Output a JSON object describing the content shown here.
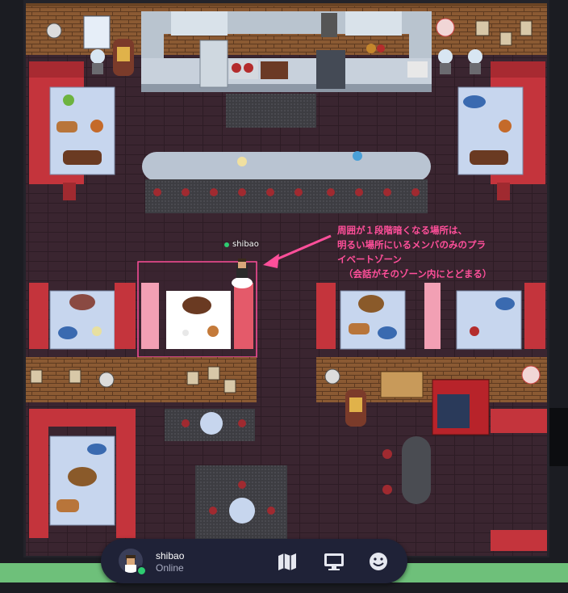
{
  "player": {
    "name": "shibao"
  },
  "annotation": {
    "lines": [
      "周囲が１段階暗くなる場所は、",
      "明るい場所にいるメンバのみのプラ",
      "イベートゾーン",
      "（会話がそのゾーン内にとどまる）"
    ],
    "color": "#ff4f9a"
  },
  "hud": {
    "user_name": "shibao",
    "user_status": "Online",
    "buttons": [
      "map-icon",
      "screen-share-icon",
      "emoji-icon"
    ]
  },
  "colors": {
    "floor": "#3a2530",
    "brick": "#8a5a34",
    "sofa": "#c4343c",
    "table": "#c7d6ee",
    "private_zone": "#ff4f9a"
  }
}
